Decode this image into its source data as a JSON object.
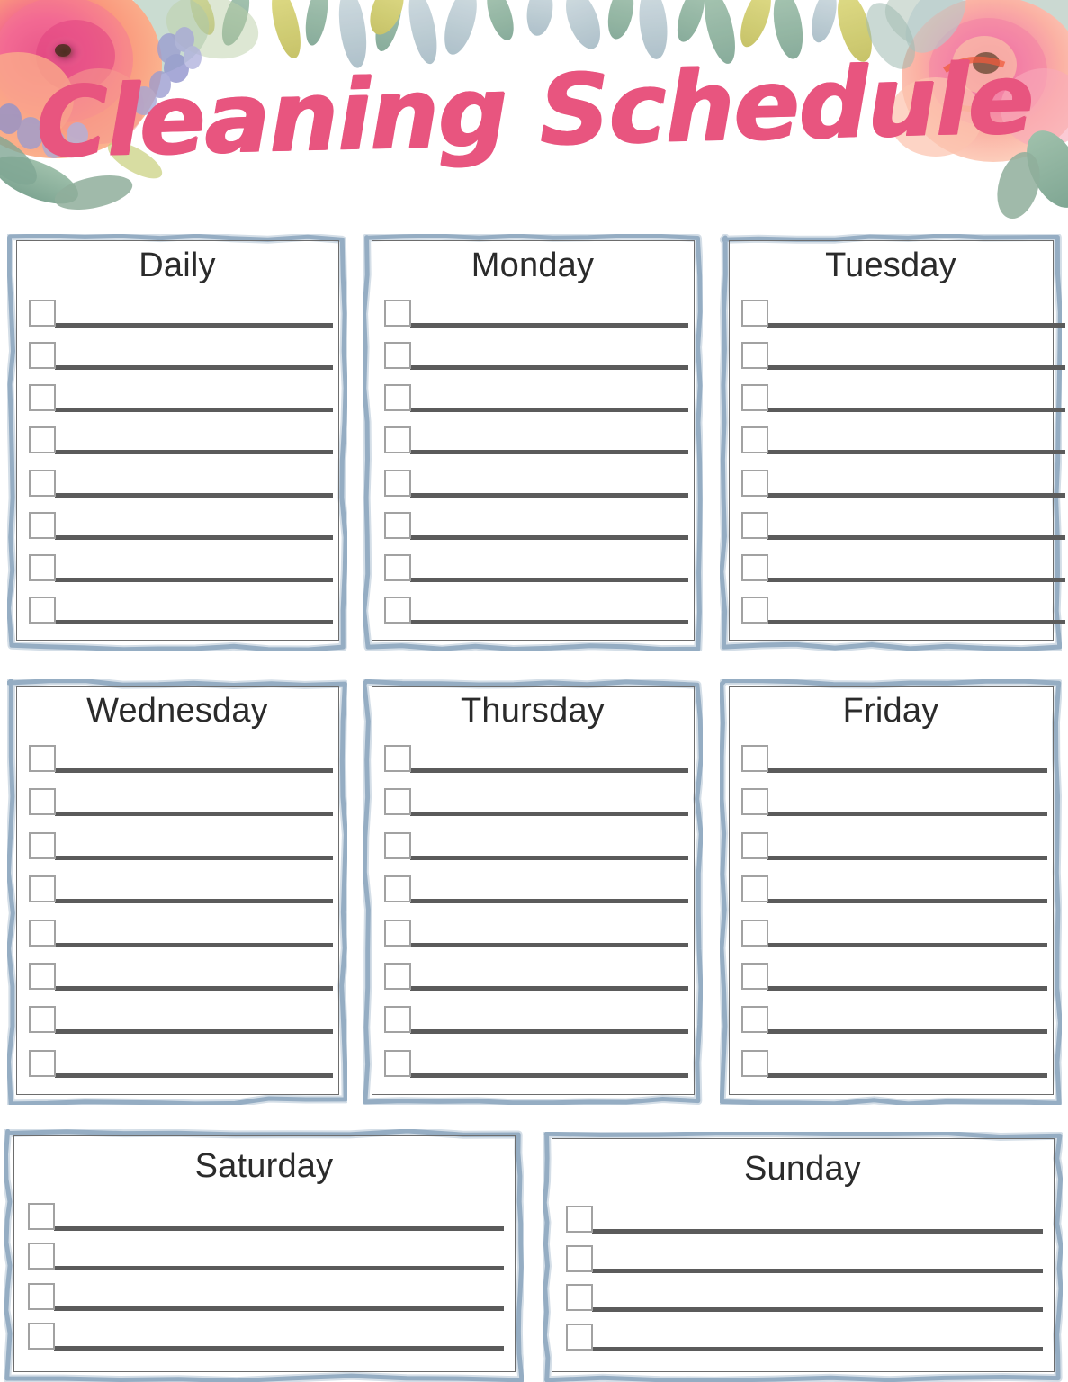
{
  "document": {
    "title": "Cleaning Schedule",
    "type": "printable-planner"
  },
  "theme": {
    "title_pink": "#e8557f",
    "frame_blue": "#8fa8c0",
    "inner_border_gray": "#6d6d6d",
    "line_gray": "#5b5b5b",
    "checkbox_border_gray": "#a2a2a2",
    "paper_white": "#ffffff",
    "leaf_sage": "#8fae9b",
    "leaf_olive": "#cdc96a",
    "leaf_blue_gray": "#b8c8cf",
    "rose_peach": "#f9a882",
    "rose_coral": "#f58a7a",
    "rose_magenta": "#e0417f",
    "rose_pink": "#f48fae",
    "lavender": "#9a9cd0"
  },
  "header": {
    "title": "Cleaning Schedule",
    "decoration": "watercolor-floral-border",
    "flowers": [
      {
        "name": "rose-left",
        "palette": [
          "#f9a882",
          "#e0417f",
          "#f26d8c"
        ]
      },
      {
        "name": "rose-right",
        "palette": [
          "#f9b4a0",
          "#f06292",
          "#ef5b3c"
        ]
      }
    ]
  },
  "cards": [
    {
      "id": "daily",
      "title": "Daily",
      "rows": 8,
      "column": "a",
      "band": 1
    },
    {
      "id": "monday",
      "title": "Monday",
      "rows": 8,
      "column": "b",
      "band": 1
    },
    {
      "id": "tuesday",
      "title": "Tuesday",
      "rows": 8,
      "column": "c",
      "band": 1
    },
    {
      "id": "wednesday",
      "title": "Wednesday",
      "rows": 8,
      "column": "a",
      "band": 2
    },
    {
      "id": "thursday",
      "title": "Thursday",
      "rows": 8,
      "column": "b",
      "band": 2
    },
    {
      "id": "friday",
      "title": "Friday",
      "rows": 8,
      "column": "c",
      "band": 2
    },
    {
      "id": "saturday",
      "title": "Saturday",
      "rows": 4,
      "column": "wide-a",
      "band": 3
    },
    {
      "id": "sunday",
      "title": "Sunday",
      "rows": 4,
      "column": "wide-b",
      "band": 3
    }
  ]
}
